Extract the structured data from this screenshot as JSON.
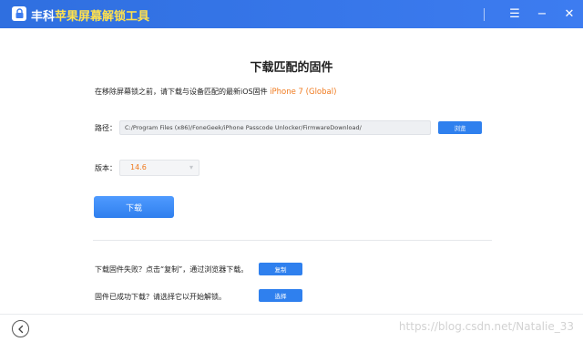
{
  "titlebar": {
    "title_prefix": "丰科",
    "title_accent": "苹果屏幕解锁工具",
    "menu_glyph": "☰",
    "minimize_glyph": "−",
    "close_glyph": "✕"
  },
  "main": {
    "heading": "下载匹配的固件",
    "intro_text": "在移除屏幕锁之前，请下载与设备匹配的最新iOS固件",
    "device_model": "iPhone 7 (Global)",
    "path_label": "路径：",
    "path_value": "C:/Program Files (x86)/FoneGeek/iPhone Passcode Unlocker/FirmwareDownload/",
    "browse_label": "浏览",
    "version_label": "版本：",
    "version_value": "14.6",
    "download_label": "下载",
    "fail_text": "下载固件失败？点击“复制”，通过浏览器下载。",
    "copy_label": "复制",
    "downloaded_text": "固件已成功下载？请选择它以开始解锁。",
    "select_label": "选择"
  },
  "footer": {
    "back_glyph": "‹",
    "watermark": "https://blog.csdn.net/Natalie_33"
  },
  "colors": {
    "titlebar": "#3d7cf0",
    "accent_yellow": "#ffe14d",
    "highlight_orange": "#f07a1e",
    "button_blue": "#2f80ee"
  }
}
